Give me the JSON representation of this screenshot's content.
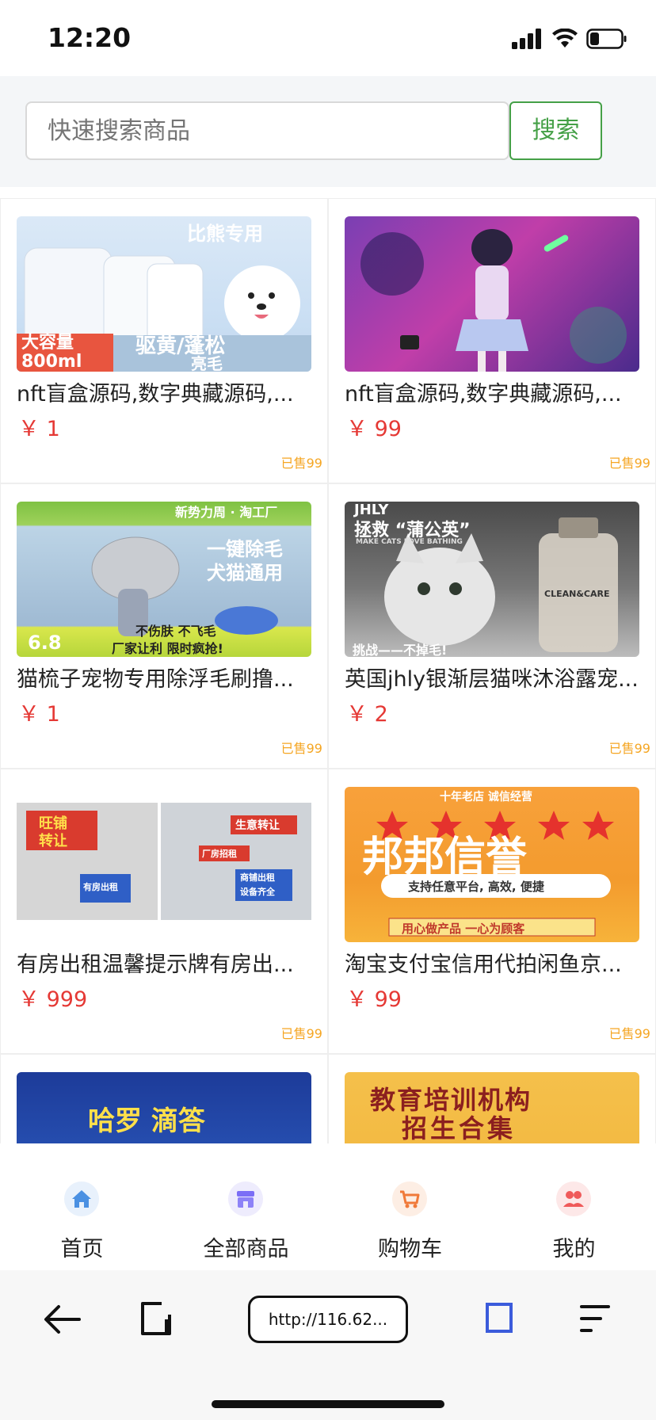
{
  "status_bar": {
    "time": "12:20"
  },
  "search": {
    "placeholder": "快速搜索商品",
    "button_label": "搜索"
  },
  "products": [
    {
      "title": "nft盲盒源码,数字典藏源码,...",
      "price": "￥ 1",
      "sold": "已售99",
      "image_text": [
        "比熊专用",
        "大容量",
        "800ml",
        "驱黄/蓬松",
        "亮毛"
      ]
    },
    {
      "title": "nft盲盒源码,数字典藏源码,...",
      "price": "￥ 99",
      "sold": "已售99",
      "image_text": []
    },
    {
      "title": "猫梳子宠物专用除浮毛刷撸...",
      "price": "￥ 1",
      "sold": "已售99",
      "image_text": [
        "新势力周 · 淘工厂",
        "一键除毛",
        "犬猫通用",
        "6.8",
        "不伤肤 不飞毛",
        "厂家让利 限时疯抢!"
      ]
    },
    {
      "title": "英国jhly银渐层猫咪沐浴露宠...",
      "price": "￥ 2",
      "sold": "已售99",
      "image_text": [
        "JHLY",
        "拯救 “蒲公英”",
        "MAKE CATS LOVE BATHING",
        "CLEAN&CARE",
        "挑战——不掉毛!"
      ]
    },
    {
      "title": "有房出租温馨提示牌有房出...",
      "price": "￥ 999",
      "sold": "已售99",
      "image_text": [
        "旺铺",
        "转让",
        "生意转让",
        "厂房招租",
        "有房出租",
        "商铺出租",
        "设备齐全"
      ]
    },
    {
      "title": "淘宝支付宝信用代拍闲鱼京...",
      "price": "￥ 99",
      "sold": "已售99",
      "image_text": [
        "十年老店 诚信经营",
        "邦邦信誉",
        "支持任意平台, 高效, 便捷",
        "用心做产品 一心为顾客"
      ]
    },
    {
      "title": "",
      "price": "",
      "sold": "",
      "image_text": [
        "哈罗 滴答"
      ]
    },
    {
      "title": "",
      "price": "",
      "sold": "",
      "image_text": [
        "教育培训机构",
        "招生合集"
      ]
    }
  ],
  "tabbar": {
    "items": [
      {
        "label": "首页",
        "icon": "home-icon",
        "color": "#4a90e2"
      },
      {
        "label": "全部商品",
        "icon": "shop-icon",
        "color": "#7b6ef6"
      },
      {
        "label": "购物车",
        "icon": "cart-icon",
        "color": "#f07a3a"
      },
      {
        "label": "我的",
        "icon": "user-icon",
        "color": "#ef5a5a"
      }
    ]
  },
  "browser": {
    "url": "http://116.62..."
  },
  "colors": {
    "accent_green": "#45a047",
    "price_red": "#e53935",
    "sold_orange": "#f5a623",
    "browser_active_blue": "#3b5bdb"
  }
}
